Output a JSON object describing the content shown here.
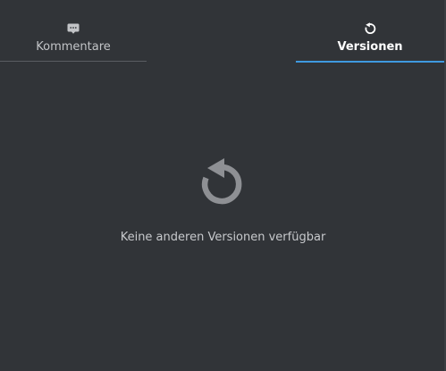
{
  "tabs": {
    "comments": {
      "label": "Kommentare",
      "icon": "comment-icon"
    },
    "versions": {
      "label": "Versionen",
      "icon": "history-icon",
      "active": true
    }
  },
  "empty_state": {
    "icon": "history-icon",
    "message": "Keine anderen Versionen verfügbar"
  },
  "colors": {
    "background": "#313438",
    "accent": "#3f9ae0",
    "active_text": "#ffffff",
    "inactive_text": "#c2c4c7",
    "icon_muted": "#8e9094"
  }
}
